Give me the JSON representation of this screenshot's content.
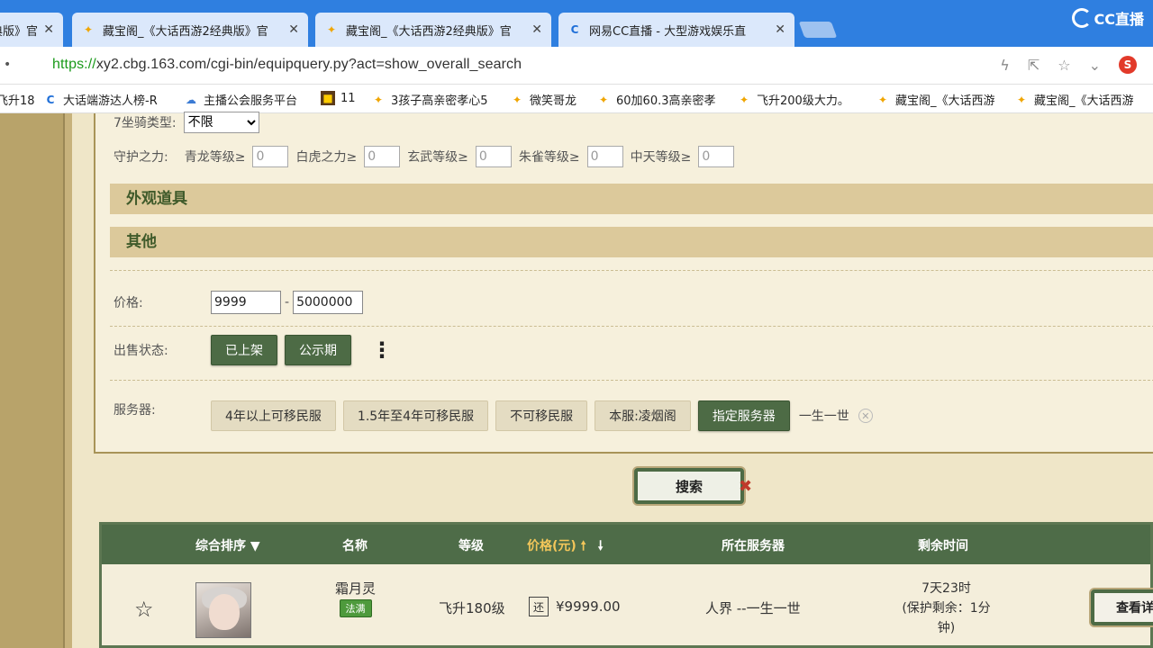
{
  "browser": {
    "tabs": [
      {
        "title": "典版》官",
        "icon": "page-icon"
      },
      {
        "title": "藏宝阁_《大话西游2经典版》官",
        "icon": "chick-icon"
      },
      {
        "title": "藏宝阁_《大话西游2经典版》官",
        "icon": "chick-icon"
      },
      {
        "title": "网易CC直播 - 大型游戏娱乐直",
        "icon": "cc-icon"
      }
    ],
    "close_glyph": "✕",
    "brand": "CC直播",
    "url_scheme": "https://",
    "url_rest": "xy2.cbg.163.com/cgi-bin/equipquery.py?act=show_overall_search",
    "bookmarks": [
      "飞升18",
      "大话端游达人榜-R",
      "主播公会服务平台",
      "11",
      "3孩子高亲密孝心5",
      "微笑哥龙",
      "60加60.3高亲密孝",
      "飞升200级大力。",
      "藏宝阁_《大话西游",
      "藏宝阁_《大话西游"
    ]
  },
  "form": {
    "mount_label": "7坐骑类型:",
    "mount_value": "不限",
    "guard_label": "守护之力:",
    "guard_fields": [
      {
        "label": "青龙等级≥",
        "value": "0"
      },
      {
        "label": "白虎之力≥",
        "value": "0"
      },
      {
        "label": "玄武等级≥",
        "value": "0"
      },
      {
        "label": "朱雀等级≥",
        "value": "0"
      },
      {
        "label": "中天等级≥",
        "value": "0"
      }
    ],
    "section_appearance": "外观道具",
    "section_other": "其他",
    "price_label": "价格:",
    "price_min": "9999",
    "price_sep": "-",
    "price_max": "5000000",
    "status_label": "出售状态:",
    "status_buttons": [
      "已上架",
      "公示期"
    ],
    "more_glyph": "⋮",
    "server_label": "服务器:",
    "server_buttons": [
      "4年以上可移民服",
      "1.5年至4年可移民服",
      "不可移民服",
      "本服:凌烟阁"
    ],
    "server_selected_button": "指定服务器",
    "server_chosen": "一生一世",
    "clear_glyph": "✕"
  },
  "search_label": "搜索",
  "table": {
    "headers": {
      "sort": "综合排序",
      "name": "名称",
      "level": "等级",
      "price": "价格(元)",
      "server": "所在服务器",
      "remaining": "剩余时间"
    },
    "rows": [
      {
        "name": "霜月灵",
        "badge": "法满",
        "level": "飞升180级",
        "haggle": "还",
        "price": "¥9999.00",
        "server": "人界 --一生一世",
        "time_1": "7天23时",
        "time_2": "(保护剩余：1分",
        "time_3": "钟)",
        "view_label": "查看详情"
      }
    ]
  }
}
